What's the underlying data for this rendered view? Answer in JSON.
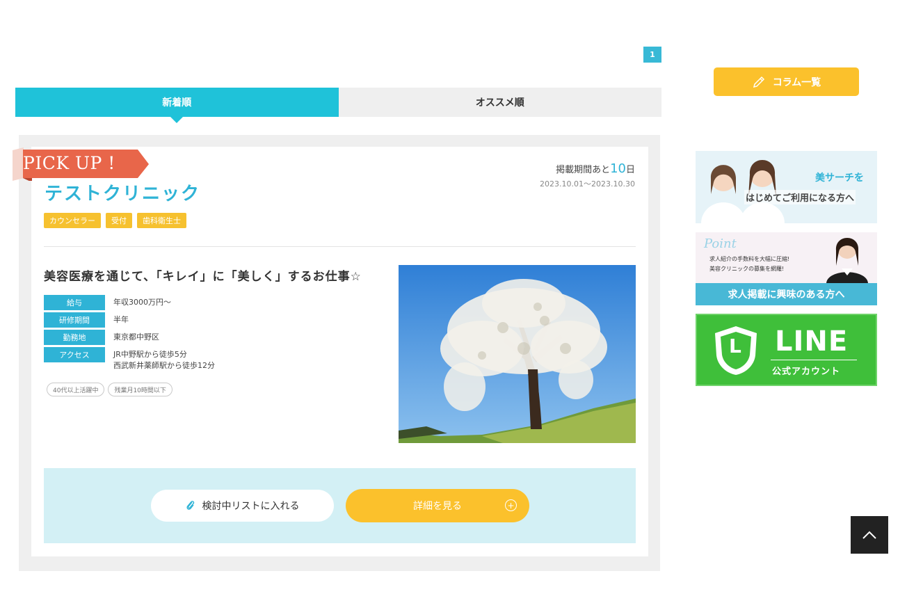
{
  "pagination": {
    "current": "1"
  },
  "sort_tabs": [
    {
      "label": "新着順",
      "active": true
    },
    {
      "label": "オススメ順",
      "active": false
    }
  ],
  "job": {
    "pickup_label": "PICK UP !",
    "clinic_name": "テストクリニック",
    "period_label": "掲載期間あと",
    "period_days": "10",
    "period_unit": "日",
    "period_range": "2023.10.01～2023.10.30",
    "tags": [
      "カウンセラー",
      "受付",
      "歯科衛生士"
    ],
    "headline": "美容医療を通じて、「キレイ」に「美しく」するお仕事☆",
    "info": [
      {
        "key": "給与",
        "value": "年収3000万円～"
      },
      {
        "key": "研修期間",
        "value": "半年"
      },
      {
        "key": "勤務地",
        "value": "東京都中野区"
      },
      {
        "key": "アクセス",
        "value": "JR中野駅から徒歩5分",
        "value2": "西武新井薬師駅から徒歩12分"
      }
    ],
    "feature_tags": [
      "40代以上活躍中",
      "残業月10時間以下"
    ],
    "photo_icon": "blossoming-tree-photo",
    "buttons": {
      "list": "検討中リストに入れる",
      "detail": "詳細を見る"
    }
  },
  "sidebar": {
    "column_button": "コラム一覧",
    "banner1": {
      "line1": "美サーチを",
      "line2": "はじめてご利用になる方へ"
    },
    "banner2": {
      "point": "Point",
      "line1": "求人紹介の手数料を大幅に圧縮!",
      "line2": "美容クリニックの募集を網羅!",
      "cta": "求人掲載に興味のある方へ"
    },
    "banner3": {
      "title": "LINE",
      "subtitle": "公式アカウント",
      "logo": "L"
    }
  },
  "colors": {
    "accent": "#1fc2d9",
    "brand_blue": "#2fb3d6",
    "yellow": "#fbc12c",
    "pickup": "#e8664a",
    "line_green": "#3fbf3a"
  }
}
